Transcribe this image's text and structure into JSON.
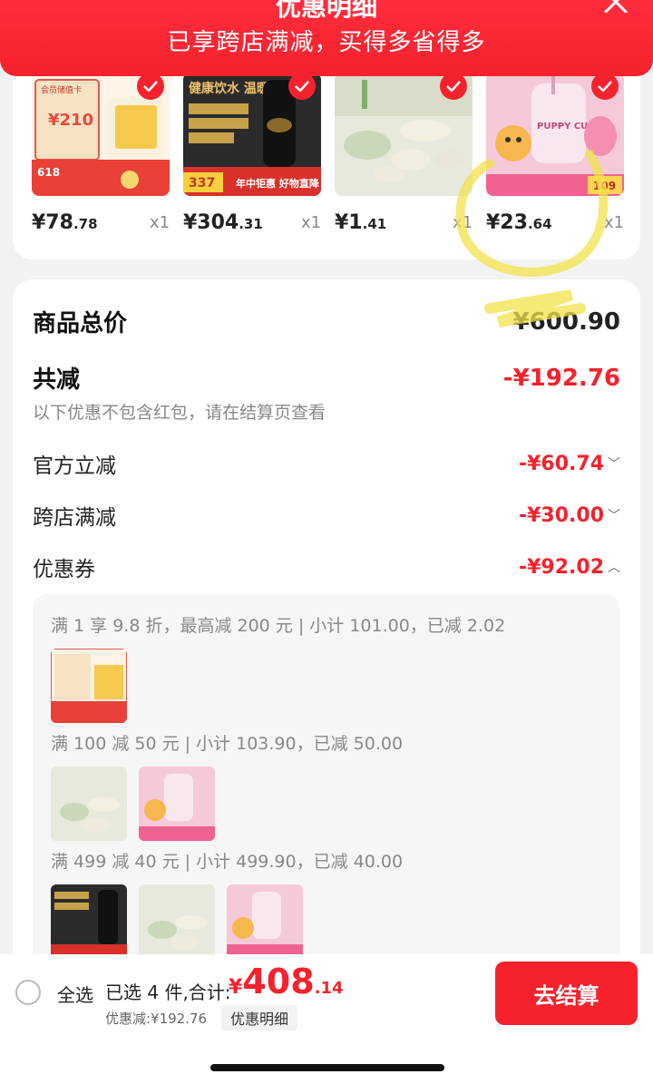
{
  "header": {
    "title": "优惠明细",
    "subtitle": "已享跨店满减，买得多省得多"
  },
  "products": [
    {
      "price_int": "¥78",
      "price_dec": ".78",
      "qty": "x1",
      "icon": "milk-formula-product",
      "tag": "会员储值卡",
      "badge": "¥210"
    },
    {
      "price_int": "¥304",
      "price_dec": ".31",
      "qty": "x1",
      "icon": "thermos-product",
      "tag": "健康饮水 温暖有度",
      "badge": "337"
    },
    {
      "price_int": "¥1",
      "price_dec": ".41",
      "qty": "x1",
      "icon": "dishware-product"
    },
    {
      "price_int": "¥23",
      "price_dec": ".64",
      "qty": "x1",
      "icon": "puppy-cup-product",
      "tag": "PUPPY CUP",
      "badge": "109"
    }
  ],
  "summary": {
    "goods_total_label": "商品总价",
    "goods_total_value": "¥600.90",
    "total_discount_label": "共减",
    "total_discount_value": "-¥192.76",
    "note": "以下优惠不包含红包，请在结算页查看",
    "items": [
      {
        "label": "官方立减",
        "value": "-¥60.74",
        "chevron": "﹀"
      },
      {
        "label": "跨店满减",
        "value": "-¥30.00",
        "chevron": "﹀"
      },
      {
        "label": "优惠券",
        "value": "-¥92.02",
        "chevron": "︿"
      }
    ]
  },
  "coupons": [
    {
      "text": "满 1 享 9.8 折，最高减 200 元 | 小计 101.00，已减 2.02"
    },
    {
      "text": "满 100 减 50 元 | 小计 103.90，已减 50.00"
    },
    {
      "text": "满 499 减 40 元 | 小计 499.90，已减 40.00"
    }
  ],
  "bottom": {
    "select_all": "全选",
    "selected_text": "已选 4 件,合计:",
    "total_yen": "¥",
    "total_int": "408",
    "total_dec": ".14",
    "discount_text": "优惠减:¥192.76",
    "detail_button": "优惠明细",
    "checkout_button": "去结算"
  },
  "colors": {
    "accent": "#f5222d",
    "highlight": "#f2e24a"
  }
}
